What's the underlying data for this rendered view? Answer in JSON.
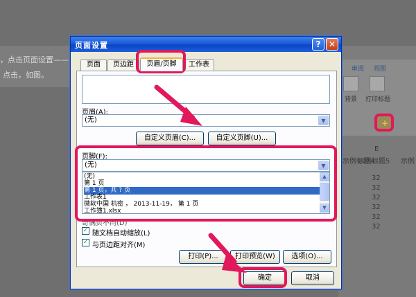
{
  "background": {
    "doc_line1": "，点击页面设置——",
    "doc_line2": "点击，如图。",
    "ribbon_tab1": "审阅",
    "ribbon_tab2": "视图",
    "ribbon_btn1": "背景",
    "ribbon_btn2": "打印标题",
    "col_letter": "E",
    "col_header1": "示例标题4",
    "col_header2": "示例标题5",
    "col_header3": "示例",
    "cell_value": "32",
    "plus_glyph": "+"
  },
  "dialog": {
    "title": "页面设置",
    "help_label": "?",
    "close_label": "✕",
    "tabs": [
      {
        "label": "页面"
      },
      {
        "label": "页边距"
      },
      {
        "label": "页眉/页脚"
      },
      {
        "label": "工作表"
      }
    ],
    "header_label": "页眉(A):",
    "header_value": "(无)",
    "custom_header_button": "自定义页眉(C)...",
    "custom_footer_button": "自定义页脚(U)...",
    "footer_label": "页脚(F):",
    "footer_value": "(无)",
    "footer_options": [
      "(无)",
      "第 1 页",
      "第 1 页，共 ? 页",
      "工作表1",
      "微软中国 机密 ， 2013-11-19， 第 1 页",
      "工作簿1.xlsx"
    ],
    "footer_selected_index": 2,
    "odd_even_label": "奇偶页不同(D)",
    "scale_with_doc_label": "随文档自动缩放(L)",
    "scale_with_doc_checked": true,
    "align_margins_label": "与页边距对齐(M)",
    "align_margins_checked": true,
    "print_button": "打印(P)...",
    "preview_button": "打印预览(W)",
    "options_button": "选项(O)...",
    "ok_button": "确定",
    "cancel_button": "取消",
    "check_glyph": "✓",
    "dropdown_glyph": "▼",
    "scroll_up_glyph": "▲",
    "scroll_down_glyph": "▼"
  },
  "colors": {
    "highlight": "#e1185b",
    "xp_title_blue": "#0a46c8",
    "selection": "#316ac5"
  }
}
